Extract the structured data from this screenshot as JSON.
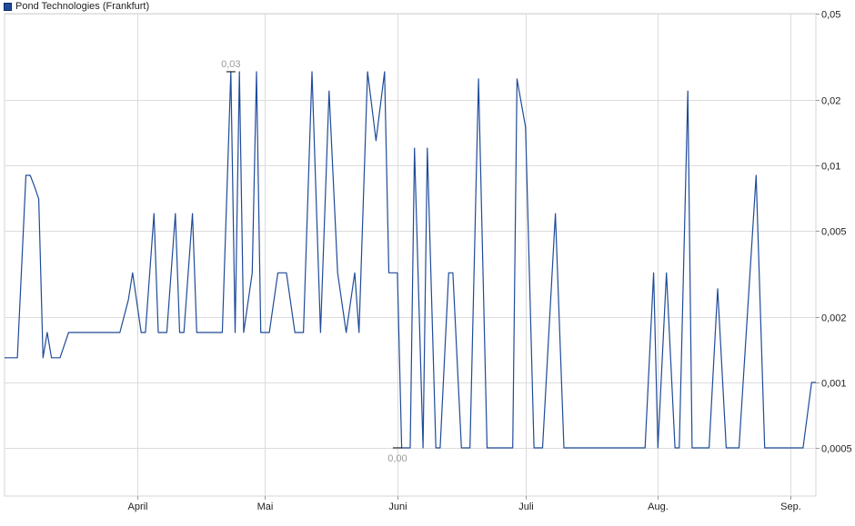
{
  "chart_data": {
    "type": "line",
    "legend": {
      "label": "Pond Technologies (Frankfurt)",
      "placement": "top-left"
    },
    "series_color": "#1f4b99",
    "grid": true,
    "y_scale": "log",
    "ylim": [
      0.0003,
      0.05
    ],
    "y_ticks": [
      {
        "value": 0.0005,
        "label": "0,0005"
      },
      {
        "value": 0.001,
        "label": "0,001"
      },
      {
        "value": 0.002,
        "label": "0,002"
      },
      {
        "value": 0.005,
        "label": "0,005"
      },
      {
        "value": 0.01,
        "label": "0,01"
      },
      {
        "value": 0.02,
        "label": "0,02"
      },
      {
        "value": 0.05,
        "label": "0,05"
      }
    ],
    "x_ticks": [
      {
        "date": "2023-04-01",
        "label": "April"
      },
      {
        "date": "2023-05-01",
        "label": "Mai"
      },
      {
        "date": "2023-06-01",
        "label": "Juni"
      },
      {
        "date": "2023-07-01",
        "label": "Juli"
      },
      {
        "date": "2023-08-01",
        "label": "Aug."
      },
      {
        "date": "2023-09-01",
        "label": "Sep."
      }
    ],
    "xlim": [
      "2023-03-01",
      "2023-09-07"
    ],
    "annotations": [
      {
        "date": "2023-04-23",
        "value": 0.027,
        "label": "0,03",
        "kind": "high"
      },
      {
        "date": "2023-06-01",
        "value": 0.0005,
        "label": "0,00",
        "kind": "low"
      }
    ],
    "series": [
      {
        "points": [
          [
            "2023-03-01",
            0.0013
          ],
          [
            "2023-03-02",
            0.0013
          ],
          [
            "2023-03-03",
            0.0013
          ],
          [
            "2023-03-04",
            0.0013
          ],
          [
            "2023-03-06",
            0.009
          ],
          [
            "2023-03-07",
            0.009
          ],
          [
            "2023-03-08",
            0.008
          ],
          [
            "2023-03-09",
            0.007
          ],
          [
            "2023-03-10",
            0.0013
          ],
          [
            "2023-03-11",
            0.0017
          ],
          [
            "2023-03-12",
            0.0013
          ],
          [
            "2023-03-14",
            0.0013
          ],
          [
            "2023-03-16",
            0.0017
          ],
          [
            "2023-03-18",
            0.0017
          ],
          [
            "2023-03-22",
            0.0017
          ],
          [
            "2023-03-27",
            0.0017
          ],
          [
            "2023-03-28",
            0.0017
          ],
          [
            "2023-03-30",
            0.0024
          ],
          [
            "2023-03-31",
            0.0032
          ],
          [
            "2023-04-02",
            0.0017
          ],
          [
            "2023-04-03",
            0.0017
          ],
          [
            "2023-04-05",
            0.006
          ],
          [
            "2023-04-06",
            0.0017
          ],
          [
            "2023-04-08",
            0.0017
          ],
          [
            "2023-04-10",
            0.006
          ],
          [
            "2023-04-11",
            0.0017
          ],
          [
            "2023-04-12",
            0.0017
          ],
          [
            "2023-04-14",
            0.006
          ],
          [
            "2023-04-15",
            0.0017
          ],
          [
            "2023-04-17",
            0.0017
          ],
          [
            "2023-04-21",
            0.0017
          ],
          [
            "2023-04-23",
            0.027
          ],
          [
            "2023-04-24",
            0.0017
          ],
          [
            "2023-04-25",
            0.027
          ],
          [
            "2023-04-26",
            0.0017
          ],
          [
            "2023-04-28",
            0.0032
          ],
          [
            "2023-04-29",
            0.027
          ],
          [
            "2023-04-30",
            0.0017
          ],
          [
            "2023-05-02",
            0.0017
          ],
          [
            "2023-05-04",
            0.0032
          ],
          [
            "2023-05-06",
            0.0032
          ],
          [
            "2023-05-08",
            0.0017
          ],
          [
            "2023-05-10",
            0.0017
          ],
          [
            "2023-05-12",
            0.027
          ],
          [
            "2023-05-14",
            0.0017
          ],
          [
            "2023-05-16",
            0.022
          ],
          [
            "2023-05-18",
            0.0032
          ],
          [
            "2023-05-20",
            0.0017
          ],
          [
            "2023-05-22",
            0.0032
          ],
          [
            "2023-05-23",
            0.0017
          ],
          [
            "2023-05-25",
            0.027
          ],
          [
            "2023-05-27",
            0.013
          ],
          [
            "2023-05-29",
            0.027
          ],
          [
            "2023-05-30",
            0.0032
          ],
          [
            "2023-06-01",
            0.0032
          ],
          [
            "2023-06-02",
            0.0005
          ],
          [
            "2023-06-04",
            0.0005
          ],
          [
            "2023-06-05",
            0.012
          ],
          [
            "2023-06-07",
            0.0005
          ],
          [
            "2023-06-08",
            0.012
          ],
          [
            "2023-06-10",
            0.0005
          ],
          [
            "2023-06-11",
            0.0005
          ],
          [
            "2023-06-13",
            0.0032
          ],
          [
            "2023-06-14",
            0.0032
          ],
          [
            "2023-06-16",
            0.0005
          ],
          [
            "2023-06-18",
            0.0005
          ],
          [
            "2023-06-20",
            0.025
          ],
          [
            "2023-06-22",
            0.0005
          ],
          [
            "2023-06-24",
            0.0005
          ],
          [
            "2023-06-28",
            0.0005
          ],
          [
            "2023-06-29",
            0.025
          ],
          [
            "2023-07-01",
            0.015
          ],
          [
            "2023-07-03",
            0.0005
          ],
          [
            "2023-07-05",
            0.0005
          ],
          [
            "2023-07-08",
            0.006
          ],
          [
            "2023-07-10",
            0.0005
          ],
          [
            "2023-07-15",
            0.0005
          ],
          [
            "2023-07-25",
            0.0005
          ],
          [
            "2023-07-29",
            0.0005
          ],
          [
            "2023-07-31",
            0.0032
          ],
          [
            "2023-08-01",
            0.0005
          ],
          [
            "2023-08-03",
            0.0032
          ],
          [
            "2023-08-05",
            0.0005
          ],
          [
            "2023-08-06",
            0.0005
          ],
          [
            "2023-08-08",
            0.022
          ],
          [
            "2023-08-09",
            0.0005
          ],
          [
            "2023-08-11",
            0.0005
          ],
          [
            "2023-08-13",
            0.0005
          ],
          [
            "2023-08-15",
            0.0027
          ],
          [
            "2023-08-17",
            0.0005
          ],
          [
            "2023-08-19",
            0.0005
          ],
          [
            "2023-08-20",
            0.0005
          ],
          [
            "2023-08-24",
            0.009
          ],
          [
            "2023-08-26",
            0.0005
          ],
          [
            "2023-08-29",
            0.0005
          ],
          [
            "2023-09-02",
            0.0005
          ],
          [
            "2023-09-04",
            0.0005
          ],
          [
            "2023-09-06",
            0.001
          ],
          [
            "2023-09-07",
            0.001
          ]
        ]
      }
    ]
  }
}
